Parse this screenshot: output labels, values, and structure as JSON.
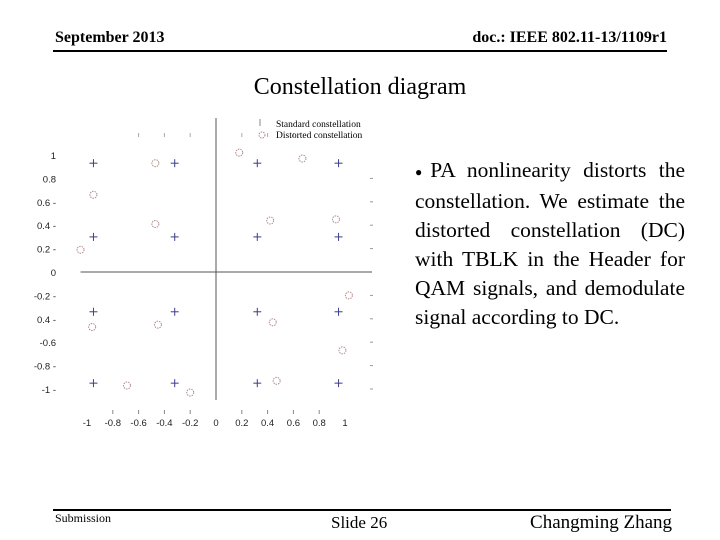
{
  "header": {
    "date": "September 2013",
    "doc_id": "doc.: IEEE 802.11-13/1109r1"
  },
  "slide_title": "Constellation diagram",
  "body": {
    "bullet": "●",
    "text": "PA nonlinearity distorts the constellation. We estimate the distorted constellation (DC) with TBLK in the Header for QAM signals, and demodulate signal according to DC."
  },
  "footer": {
    "left": "Submission",
    "center": "Slide 26",
    "right": "Changming Zhang"
  },
  "chart_data": {
    "type": "scatter",
    "title": "",
    "xlabel": "",
    "ylabel": "",
    "xlim": [
      -1,
      1
    ],
    "ylim": [
      -1,
      1
    ],
    "grid": false,
    "legend_position": "top-right",
    "x_ticks": [
      "-1",
      "-0.8",
      "-0.6",
      "-0.4",
      "-0.2",
      "0",
      "0.2",
      "0.4",
      "0.6",
      "0.8",
      "1"
    ],
    "y_ticks": [
      "1",
      "0.8",
      "0.6",
      "0.4",
      "0.2",
      "0",
      "-0.2",
      "-0.4",
      "-0.6",
      "-0.8",
      "-1"
    ],
    "y_tick_labels_shown": [
      "1",
      "0.8",
      "0.6 -",
      "0.4 -",
      "0.2 -",
      "0",
      "-0.2 -",
      "0.4 -",
      "-0.6",
      "-0.8 -",
      "-1 -"
    ],
    "series": [
      {
        "name": "Standard constellation",
        "marker": "plus",
        "color": "#3c3c8c",
        "points": [
          [
            -0.95,
            0.93
          ],
          [
            -0.32,
            0.93
          ],
          [
            0.32,
            0.93
          ],
          [
            0.95,
            0.93
          ],
          [
            -0.95,
            0.3
          ],
          [
            -0.32,
            0.3
          ],
          [
            0.32,
            0.3
          ],
          [
            0.95,
            0.3
          ],
          [
            -0.95,
            -0.34
          ],
          [
            -0.32,
            -0.34
          ],
          [
            0.32,
            -0.34
          ],
          [
            0.95,
            -0.34
          ],
          [
            -0.95,
            -0.95
          ],
          [
            -0.32,
            -0.95
          ],
          [
            0.32,
            -0.95
          ],
          [
            0.95,
            -0.95
          ]
        ]
      },
      {
        "name": "Distorted constellation",
        "marker": "circle",
        "color": "#b08a8a",
        "points": [
          [
            -0.47,
            0.93
          ],
          [
            -0.95,
            0.66
          ],
          [
            -0.47,
            0.41
          ],
          [
            -1.05,
            0.19
          ],
          [
            0.18,
            1.02
          ],
          [
            0.67,
            0.97
          ],
          [
            0.42,
            0.44
          ],
          [
            0.93,
            0.45
          ],
          [
            1.03,
            -0.2
          ],
          [
            0.44,
            -0.43
          ],
          [
            0.98,
            -0.67
          ],
          [
            0.47,
            -0.93
          ],
          [
            -0.96,
            -0.47
          ],
          [
            -0.45,
            -0.45
          ],
          [
            -0.69,
            -0.97
          ],
          [
            -0.2,
            -1.03
          ]
        ]
      }
    ]
  }
}
